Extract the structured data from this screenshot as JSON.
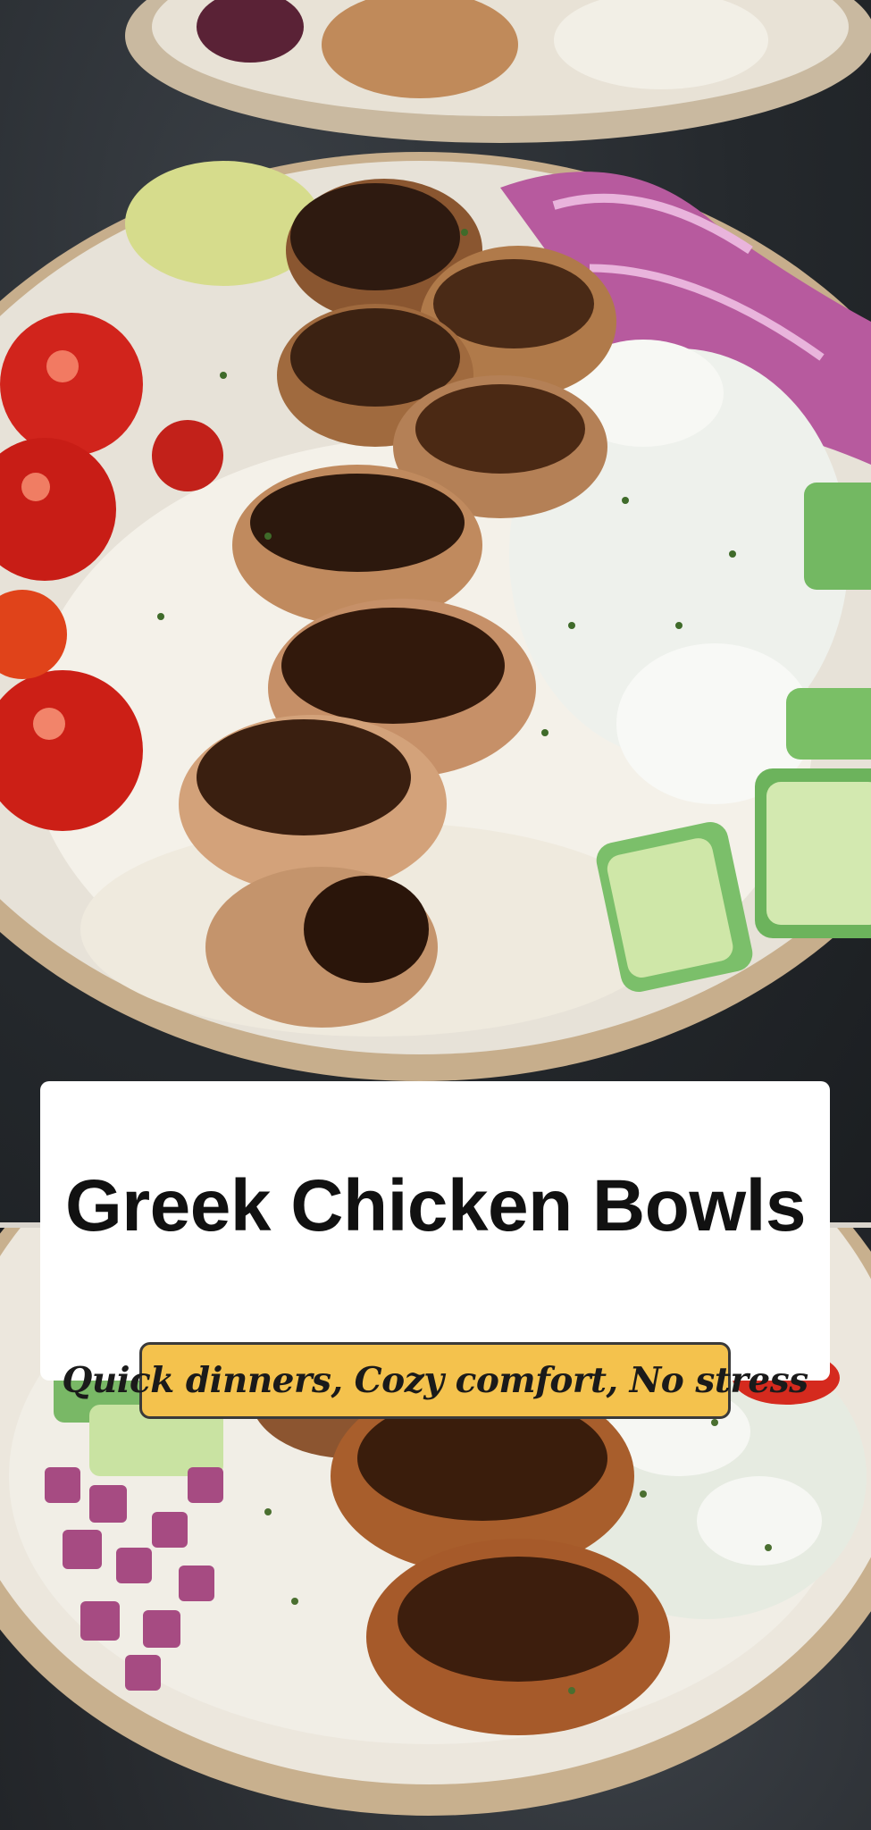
{
  "pin": {
    "title": "Greek Chicken Bowls",
    "tagline": "Quick dinners, Cozy comfort, No stress"
  },
  "colors": {
    "title_card": "#ffffff",
    "tagline_badge": "#f4c24d",
    "title_text": "#111111",
    "background": "#1e2124"
  },
  "images": {
    "top": "photo-greek-chicken-bowl-tomatoes-cucumber-feta",
    "bottom": "photo-greek-chicken-bowl-onion-feta"
  }
}
